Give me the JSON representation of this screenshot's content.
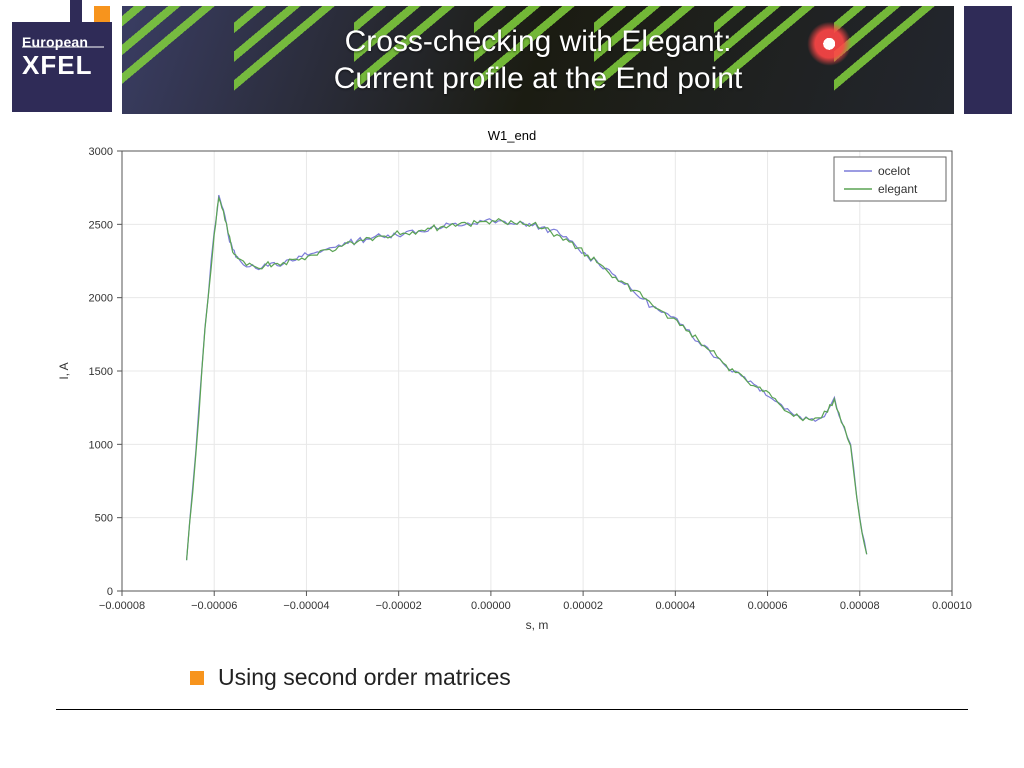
{
  "logo": {
    "line1": "European",
    "line2": "XFEL"
  },
  "title_line1": "Cross-checking with Elegant:",
  "title_line2": "Current profile at the End point",
  "bullet": "Using second order matrices",
  "chart_data": {
    "type": "line",
    "title": "W1_end",
    "xlabel": "s, m",
    "ylabel": "I, A",
    "xlim": [
      -8e-05,
      0.0001
    ],
    "ylim": [
      0,
      3000
    ],
    "xticks": [
      -8e-05,
      -6e-05,
      -4e-05,
      -2e-05,
      0.0,
      2e-05,
      4e-05,
      6e-05,
      8e-05,
      0.0001
    ],
    "yticks": [
      0,
      500,
      1000,
      1500,
      2000,
      2500,
      3000
    ],
    "legend": [
      "ocelot",
      "elegant"
    ],
    "legend_pos": "upper right",
    "grid": true,
    "x": [
      -6.6e-05,
      -6.4e-05,
      -6.2e-05,
      -6e-05,
      -5.9e-05,
      -5.8e-05,
      -5.7e-05,
      -5.6e-05,
      -5.5e-05,
      -5.3e-05,
      -5.1e-05,
      -4.9e-05,
      -4.7e-05,
      -4.5e-05,
      -4.3e-05,
      -4.1e-05,
      -3.9e-05,
      -3.7e-05,
      -3.5e-05,
      -3.3e-05,
      -3.1e-05,
      -2.9e-05,
      -2.7e-05,
      -2.5e-05,
      -2.3e-05,
      -2.1e-05,
      -1.9e-05,
      -1.7e-05,
      -1.5e-05,
      -1.3e-05,
      -1.1e-05,
      -9e-06,
      -7e-06,
      -5e-06,
      -3e-06,
      -1e-06,
      1e-06,
      3e-06,
      5e-06,
      7e-06,
      9e-06,
      1.1e-05,
      1.3e-05,
      1.5e-05,
      1.7e-05,
      1.9e-05,
      2.1e-05,
      2.3e-05,
      2.5e-05,
      2.7e-05,
      2.9e-05,
      3.1e-05,
      3.3e-05,
      3.5e-05,
      3.7e-05,
      3.9e-05,
      4.1e-05,
      4.3e-05,
      4.5e-05,
      4.7e-05,
      4.9e-05,
      5.1e-05,
      5.3e-05,
      5.5e-05,
      5.7e-05,
      5.9e-05,
      6.1e-05,
      6.3e-05,
      6.5e-05,
      6.7e-05,
      6.9e-05,
      7.1e-05,
      7.3e-05,
      7.45e-05,
      7.6e-05,
      7.8e-05,
      8e-05,
      8.15e-05
    ],
    "series": [
      {
        "name": "ocelot",
        "color": "#7b7bd8",
        "values": [
          210,
          950,
          1800,
          2450,
          2700,
          2600,
          2430,
          2330,
          2280,
          2210,
          2200,
          2230,
          2240,
          2230,
          2250,
          2280,
          2300,
          2310,
          2340,
          2360,
          2370,
          2390,
          2400,
          2420,
          2410,
          2440,
          2430,
          2460,
          2450,
          2480,
          2470,
          2500,
          2490,
          2510,
          2500,
          2530,
          2510,
          2520,
          2500,
          2510,
          2490,
          2480,
          2460,
          2430,
          2390,
          2330,
          2280,
          2250,
          2200,
          2150,
          2090,
          2040,
          1990,
          1940,
          1900,
          1870,
          1820,
          1780,
          1700,
          1660,
          1590,
          1530,
          1500,
          1460,
          1410,
          1370,
          1310,
          1270,
          1220,
          1190,
          1170,
          1170,
          1230,
          1320,
          1160,
          1000,
          500,
          250
        ]
      },
      {
        "name": "elegant",
        "color": "#5aa353",
        "values": [
          210,
          930,
          1790,
          2430,
          2680,
          2590,
          2440,
          2310,
          2270,
          2220,
          2210,
          2220,
          2230,
          2240,
          2260,
          2270,
          2290,
          2320,
          2330,
          2350,
          2380,
          2380,
          2410,
          2410,
          2420,
          2430,
          2440,
          2450,
          2460,
          2470,
          2480,
          2490,
          2500,
          2500,
          2510,
          2520,
          2520,
          2510,
          2510,
          2500,
          2500,
          2470,
          2450,
          2420,
          2380,
          2340,
          2290,
          2240,
          2190,
          2140,
          2100,
          2050,
          2000,
          1950,
          1910,
          1860,
          1810,
          1770,
          1710,
          1650,
          1600,
          1540,
          1490,
          1450,
          1400,
          1360,
          1320,
          1260,
          1210,
          1180,
          1170,
          1180,
          1220,
          1310,
          1150,
          990,
          490,
          250
        ]
      }
    ]
  }
}
